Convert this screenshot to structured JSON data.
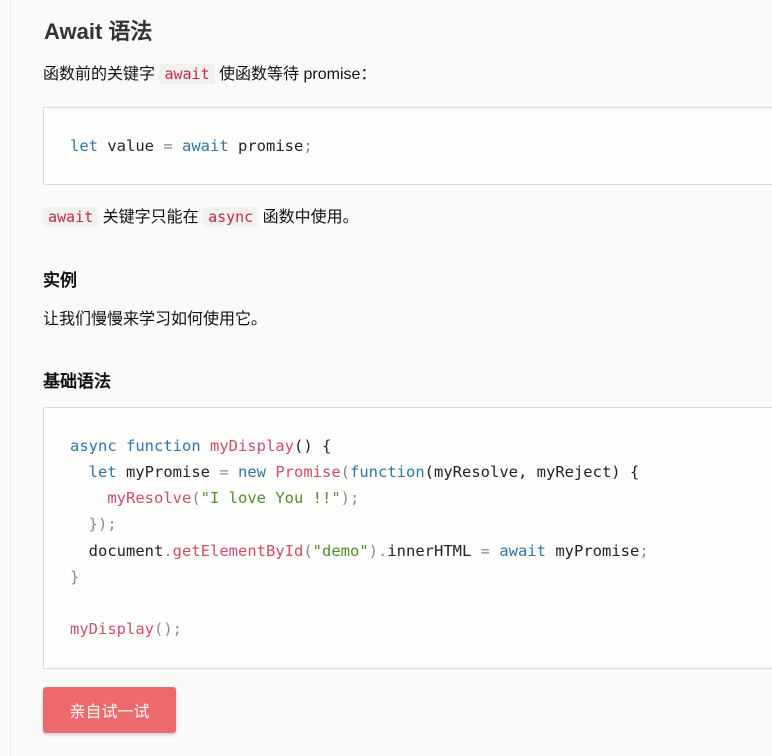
{
  "section": {
    "title": "Await 语法",
    "intro_prefix": "函数前的关键字 ",
    "intro_code": "await",
    "intro_suffix": " 使函数等待 promise："
  },
  "code1": {
    "kw_let": "let",
    "ident": " value ",
    "eq": "=",
    "kw_await": " await",
    "rest": " promise",
    "semi": ";"
  },
  "note": {
    "code_await": "await",
    "mid": " 关键字只能在 ",
    "code_async": "async",
    "suffix": " 函数中使用。"
  },
  "example": {
    "heading": "实例",
    "text": "让我们慢慢来学习如何使用它。"
  },
  "basic": {
    "heading": "基础语法"
  },
  "code2": {
    "l1_kw": "async function ",
    "l1_fn": "myDisplay",
    "l1_rest": "() {",
    "l2_kw": "let",
    "l2_id": " myPromise ",
    "l2_eq": "=",
    "l2_new": " new ",
    "l2_cls": "Promise",
    "l2_p": "(",
    "l2_fkw": "function",
    "l2_args": "(myResolve, myReject) {",
    "l3_fn": "myResolve",
    "l3_p1": "(",
    "l3_str": "\"I love You !!\"",
    "l3_p2": ");",
    "l4": "});",
    "l5_doc": "document",
    "l5_dot": ".",
    "l5_fn": "getElementById",
    "l5_p1": "(",
    "l5_str": "\"demo\"",
    "l5_p2": ").",
    "l5_prop": "innerHTML ",
    "l5_eq": "=",
    "l5_await": " await",
    "l5_rest": " myPromise",
    "l5_semi": ";",
    "l6": "}",
    "l8_fn": "myDisplay",
    "l8_rest": "();"
  },
  "button": {
    "label": "亲自试一试"
  },
  "colors": {
    "keyword": "#2b77a7",
    "function": "#d14c6b",
    "string": "#4b8f29",
    "button_bg": "#ed6a6c"
  }
}
